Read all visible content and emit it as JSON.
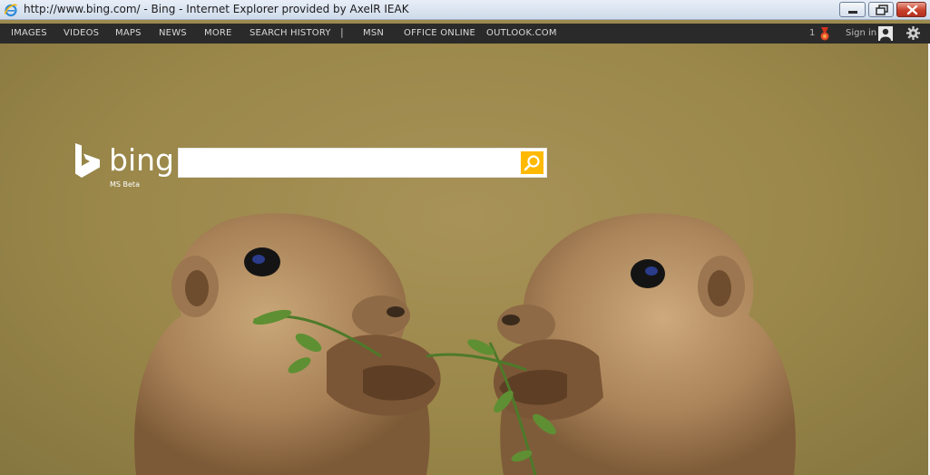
{
  "window": {
    "title": "http://www.bing.com/ - Bing - Internet Explorer provided by AxelR IEAK",
    "icon": "ie-icon",
    "controls": [
      "minimize-button",
      "maximize-button",
      "close-button"
    ]
  },
  "nav": {
    "items": [
      "IMAGES",
      "VIDEOS",
      "MAPS",
      "NEWS",
      "MORE",
      "SEARCH HISTORY"
    ],
    "separator": "|",
    "links": [
      "MSN",
      "OFFICE ONLINE",
      "OUTLOOK.COM"
    ],
    "rewards_count": "1",
    "signin_label": "Sign in"
  },
  "logo": {
    "wordmark": "bing",
    "subtitle": "MS Beta"
  },
  "search": {
    "value": "",
    "placeholder": ""
  },
  "colors": {
    "search_accent": "#ffb900",
    "nav_background": "#2a2a2a",
    "page_background": "#9c8a4e"
  }
}
